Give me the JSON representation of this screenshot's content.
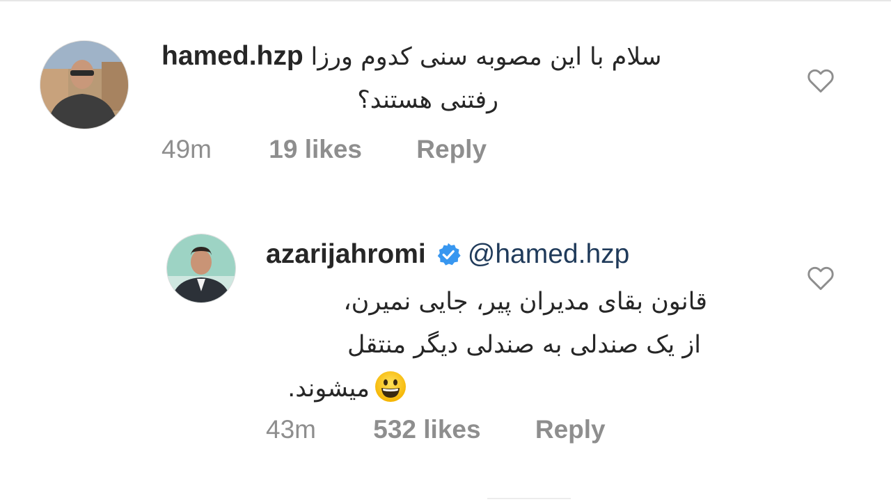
{
  "comments": [
    {
      "username": "hamed.hzp",
      "text_line1": "سلام با این مصوبه سنی کدوم ورزا",
      "text_line2": "رفتنی هستند؟",
      "time": "49m",
      "likes": "19 likes",
      "reply_label": "Reply"
    },
    {
      "username": "azarijahromi",
      "verified": true,
      "mention": "@hamed.hzp",
      "text_line1": "قانون بقای مدیران پیر، جایی نمیرن،",
      "text_line2": "از یک صندلی به صندلی دیگر منتقل",
      "text_line3": "میشوند.",
      "emoji": "grinning-face-emoji",
      "time": "43m",
      "likes": "532 likes",
      "reply_label": "Reply"
    }
  ],
  "colors": {
    "verified_badge": "#3897f0",
    "meta_text": "#8e8e8e",
    "heart_stroke": "#8e8e8e",
    "mention": "#1f3a5a"
  }
}
